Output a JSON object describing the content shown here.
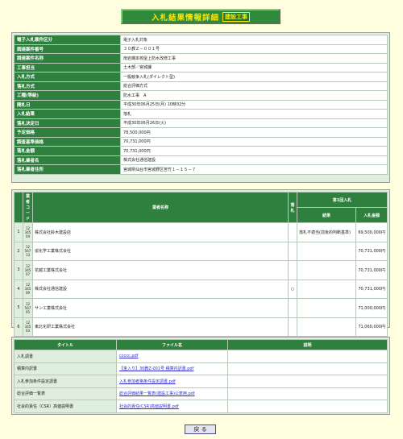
{
  "title": {
    "main": "入札結果情報詳細",
    "sub": "建設工事"
  },
  "info": [
    {
      "label": "電子入札案件区分",
      "value": "電子入札対象"
    },
    {
      "label": "調達案件番号",
      "value": "３０教Ｚ－００１号"
    },
    {
      "label": "調達案件名称",
      "value": "南岩槻本校屋上防水改修工事"
    },
    {
      "label": "工事担当",
      "value": "土木部／宮城課"
    },
    {
      "label": "入札方式",
      "value": "一般競争入札(ダイレクト型)"
    },
    {
      "label": "落札方式",
      "value": "総合評価方式"
    },
    {
      "label": "工種(等級)",
      "value": "防水工事　A"
    },
    {
      "label": "開札日",
      "value": "平成30年06月25日(月) 10時32分"
    },
    {
      "label": "入札結果",
      "value": "落札"
    },
    {
      "label": "落札決定日",
      "value": "平成30年06月26日(火)"
    },
    {
      "label": "予定価格",
      "value": "78,500,000円"
    },
    {
      "label": "調査基準価格",
      "value": "70,731,000円"
    },
    {
      "label": "落札金額",
      "value": "70,731,000円"
    },
    {
      "label": "落札業者名",
      "value": "株式会社通信建設"
    },
    {
      "label": "落札業者住所",
      "value": "宮城県仙台市宮城野区苦竹１－１５－７"
    }
  ],
  "bids": {
    "headers": {
      "no": "業者コード",
      "name": "業者名称",
      "mark": "落札",
      "group": "第1回入札",
      "result": "結果",
      "amount": "入札金額"
    },
    "rows": [
      {
        "no": "1",
        "code": [
          "12",
          "345",
          "04"
        ],
        "name": "株式会社鈴木建設店",
        "mark": "",
        "result": "落札不適当(前後的判断基準)",
        "amount": "69,500,000円"
      },
      {
        "no": "2",
        "code": [
          "12",
          "567",
          "13"
        ],
        "name": "協化学工業株式会社",
        "mark": "",
        "result": "",
        "amount": "70,731,000円"
      },
      {
        "no": "3",
        "code": [
          "12",
          "345",
          "07"
        ],
        "name": "花越工業株式会社",
        "mark": "",
        "result": "",
        "amount": "70,731,000円"
      },
      {
        "no": "4",
        "code": [
          "12",
          "345",
          "09"
        ],
        "name": "株式会社通信建設",
        "mark": "○",
        "result": "",
        "amount": "70,731,000円"
      },
      {
        "no": "5",
        "code": [
          "12",
          "567",
          "05"
        ],
        "name": "サンエ業株式会社",
        "mark": "",
        "result": "",
        "amount": "71,000,000円"
      },
      {
        "no": "6",
        "code": [
          "12",
          "345",
          "03"
        ],
        "name": "東北化研工業株式会社",
        "mark": "",
        "result": "",
        "amount": "71,060,000円"
      }
    ]
  },
  "documents": {
    "headers": {
      "title": "タイトル",
      "file": "ファイル名",
      "note": "説明"
    },
    "rows": [
      {
        "title": "入札調書",
        "file": "ccccc.pdf",
        "note": ""
      },
      {
        "title": "積算内訳書",
        "file": "【金入り】30教Z-001号 積算内訳書.pdf",
        "note": ""
      },
      {
        "title": "入札参加条件設定調書",
        "file": "入札参加者格条件設定調書.pdf",
        "note": ""
      },
      {
        "title": "総合評価一覧表",
        "file": "総合評価結果一覧表(建設工事)公表用.pdf",
        "note": ""
      },
      {
        "title": "社会的責任（CSR）高値説明書",
        "file": "社会的責任(CSR)高値説明書.pdf",
        "note": ""
      }
    ]
  },
  "back_label": "戻 る"
}
